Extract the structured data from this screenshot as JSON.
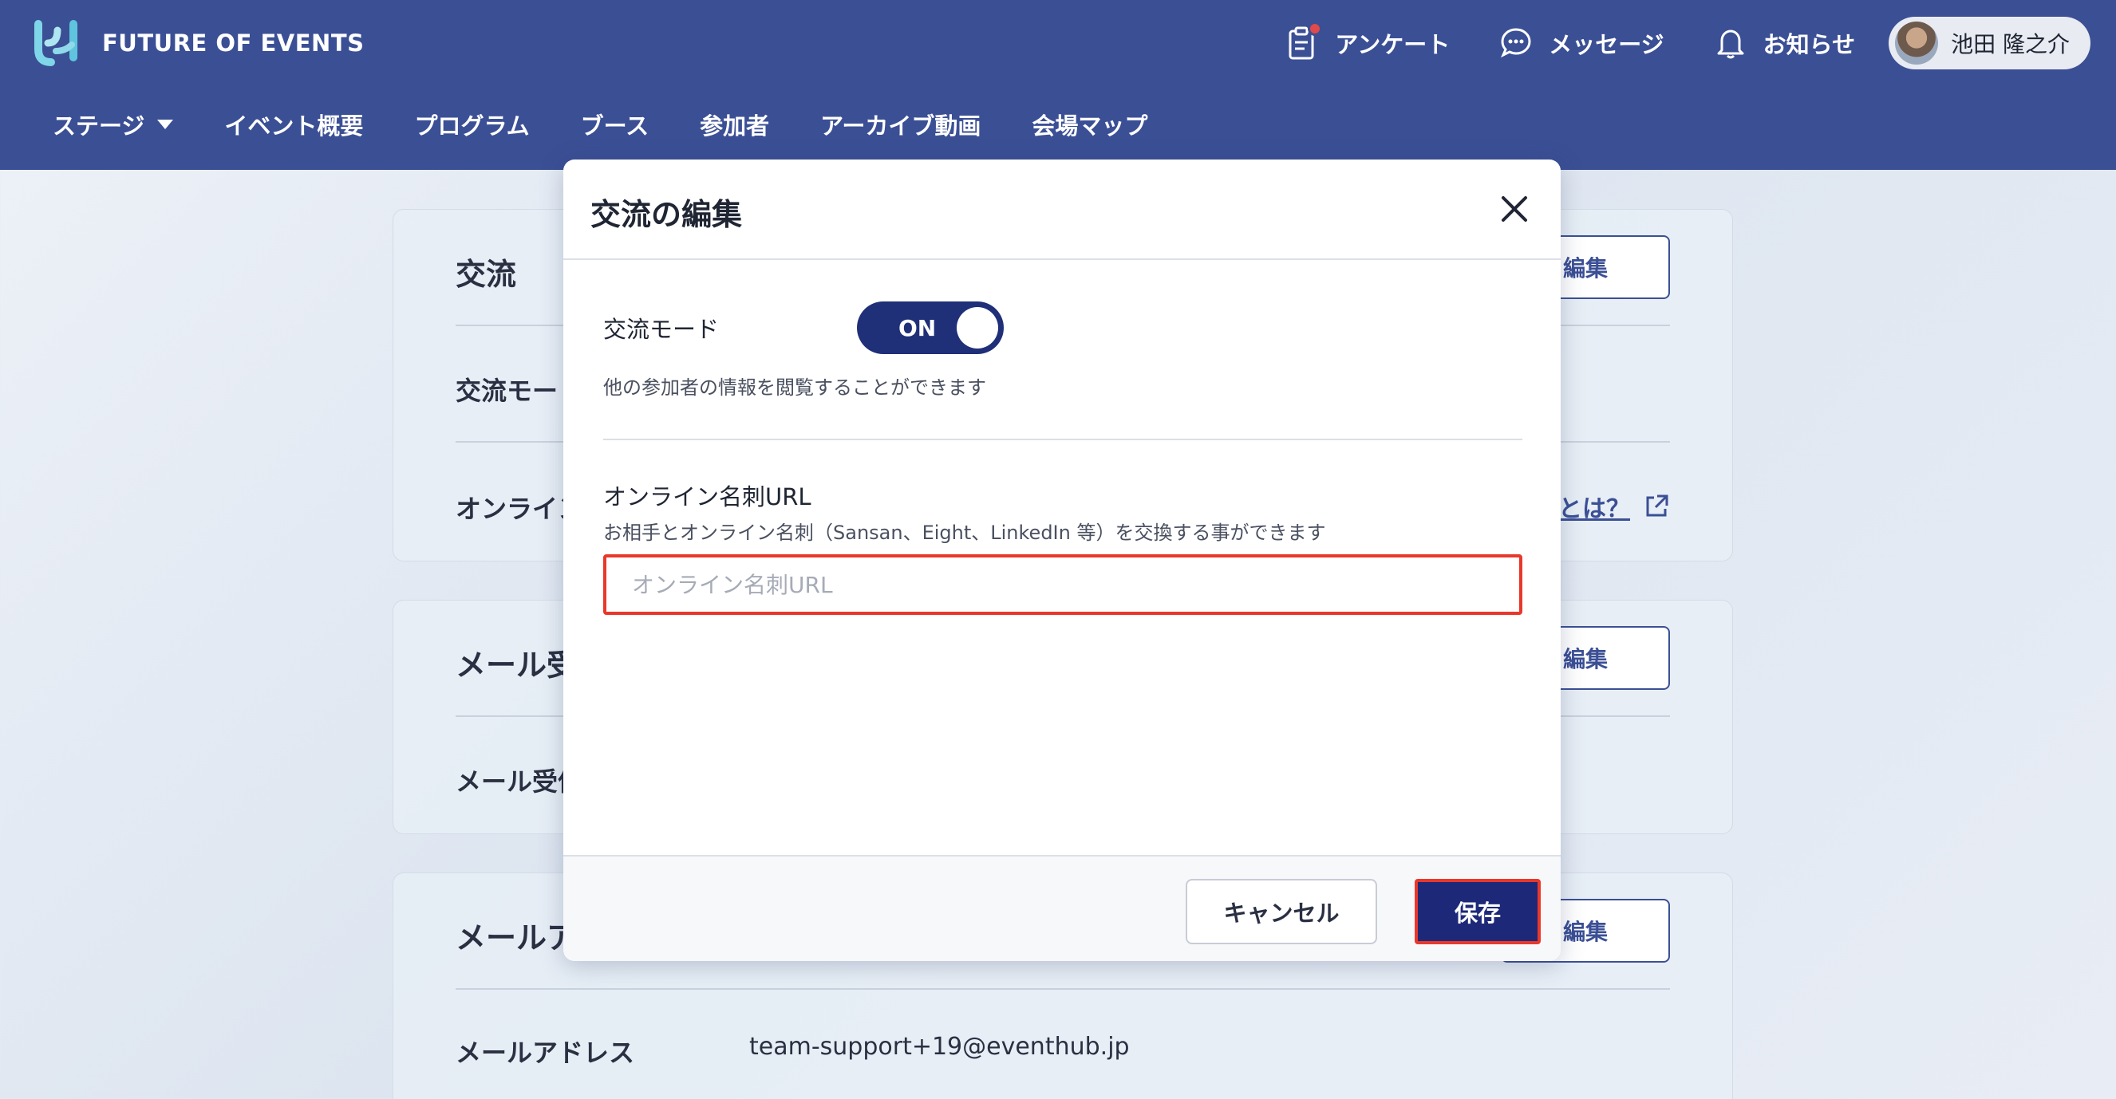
{
  "brand": {
    "name": "FUTURE OF EVENTS"
  },
  "topbar": {
    "survey": "アンケート",
    "messages": "メッセージ",
    "notifications": "お知らせ",
    "user_name": "池田 隆之介"
  },
  "nav": {
    "items": [
      "ステージ",
      "イベント概要",
      "プログラム",
      "ブース",
      "参加者",
      "アーカイブ動画",
      "会場マップ"
    ]
  },
  "cards": {
    "exchange": {
      "title": "交流",
      "row1": "交流モー",
      "row2": "オンライン",
      "edit": "編集",
      "help": "とは？"
    },
    "mail_receive": {
      "title": "メール受",
      "row1": "メール受信",
      "edit": "編集"
    },
    "mail_address": {
      "title": "メールア",
      "row1": "メールアドレス",
      "value": "team-support+19@eventhub.jp",
      "edit": "編集"
    }
  },
  "modal": {
    "title": "交流の編集",
    "toggle_label": "交流モード",
    "toggle_state": "ON",
    "toggle_desc": "他の参加者の情報を閲覧することができます",
    "url_label": "オンライン名刺URL",
    "url_desc": "お相手とオンライン名刺（Sansan、Eight、LinkedIn 等）を交換する事ができます",
    "url_placeholder": "オンライン名刺URL",
    "url_value": "",
    "cancel": "キャンセル",
    "save": "保存"
  },
  "colors": {
    "header": "#3b4f95",
    "primary": "#1d2878",
    "highlight": "#e8382b"
  }
}
